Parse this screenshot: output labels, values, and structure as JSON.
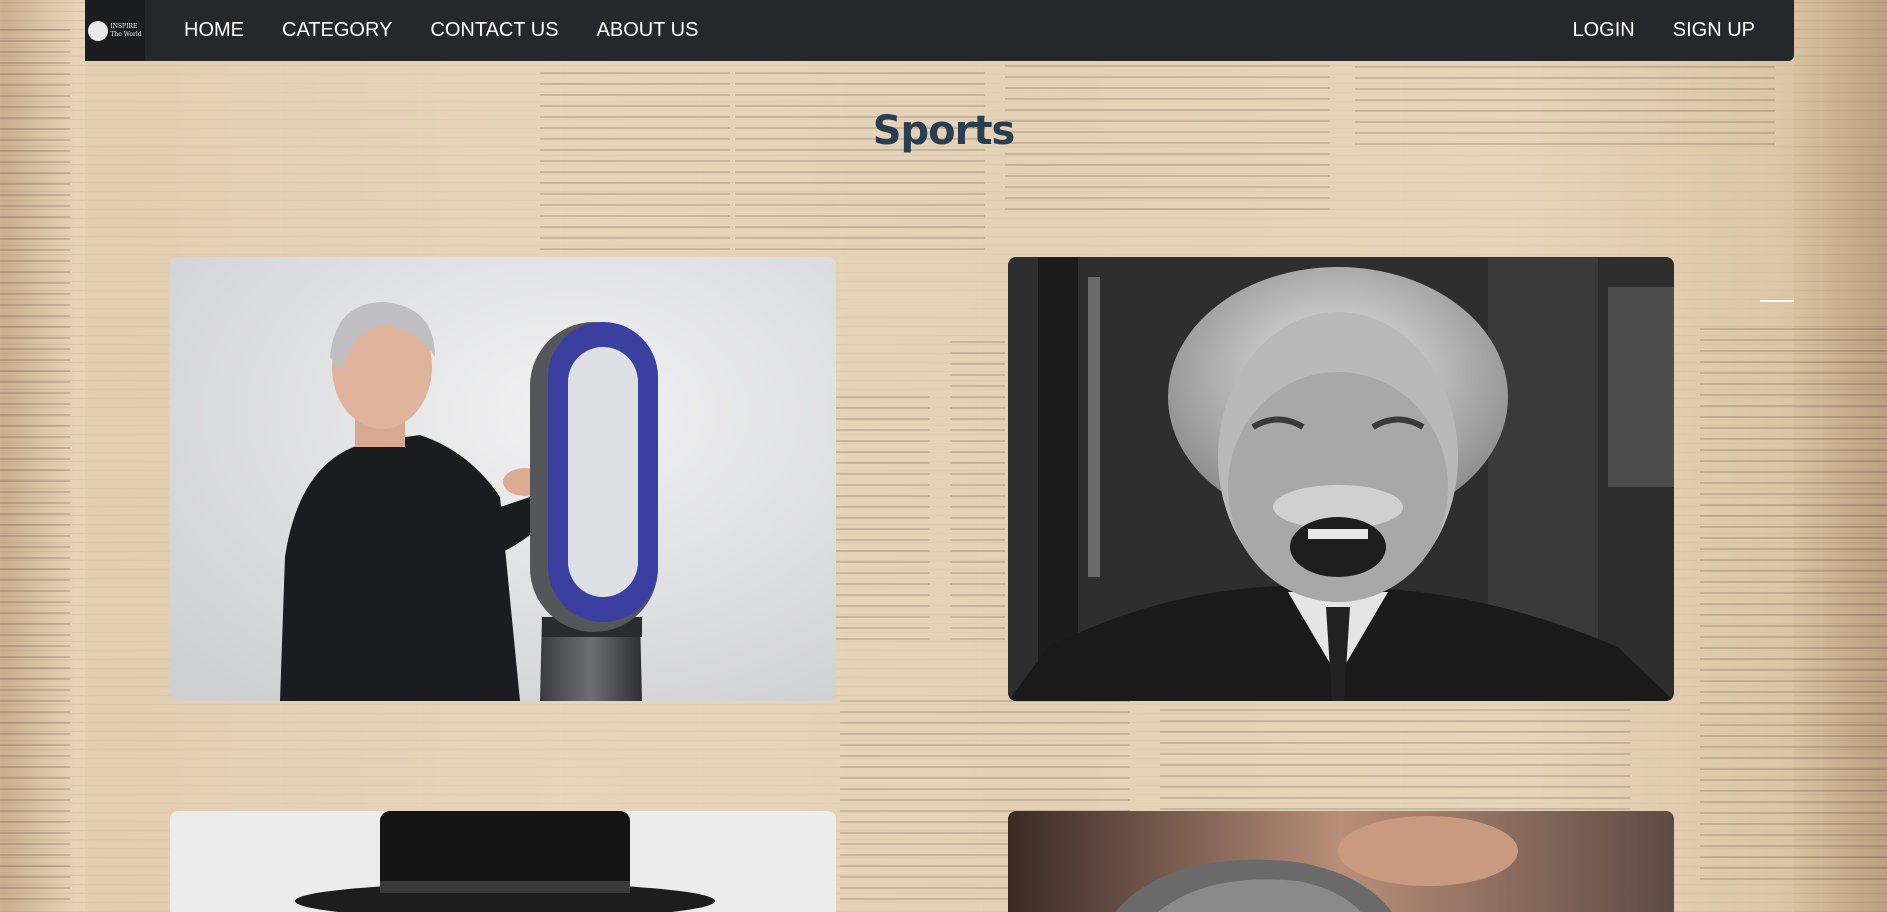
{
  "nav": {
    "logo": {
      "line1": "INSPIRE",
      "line2": "The World"
    },
    "left_links": [
      {
        "label": "HOME"
      },
      {
        "label": "CATEGORY"
      },
      {
        "label": "CONTACT US"
      },
      {
        "label": "ABOUT US"
      }
    ],
    "right_links": [
      {
        "label": "LOGIN"
      },
      {
        "label": "SIGN UP"
      }
    ]
  },
  "page": {
    "title": "Sports"
  },
  "colors": {
    "navbar": "#24272b",
    "title": "#2a3e52",
    "nav_text": "#ffffff"
  }
}
